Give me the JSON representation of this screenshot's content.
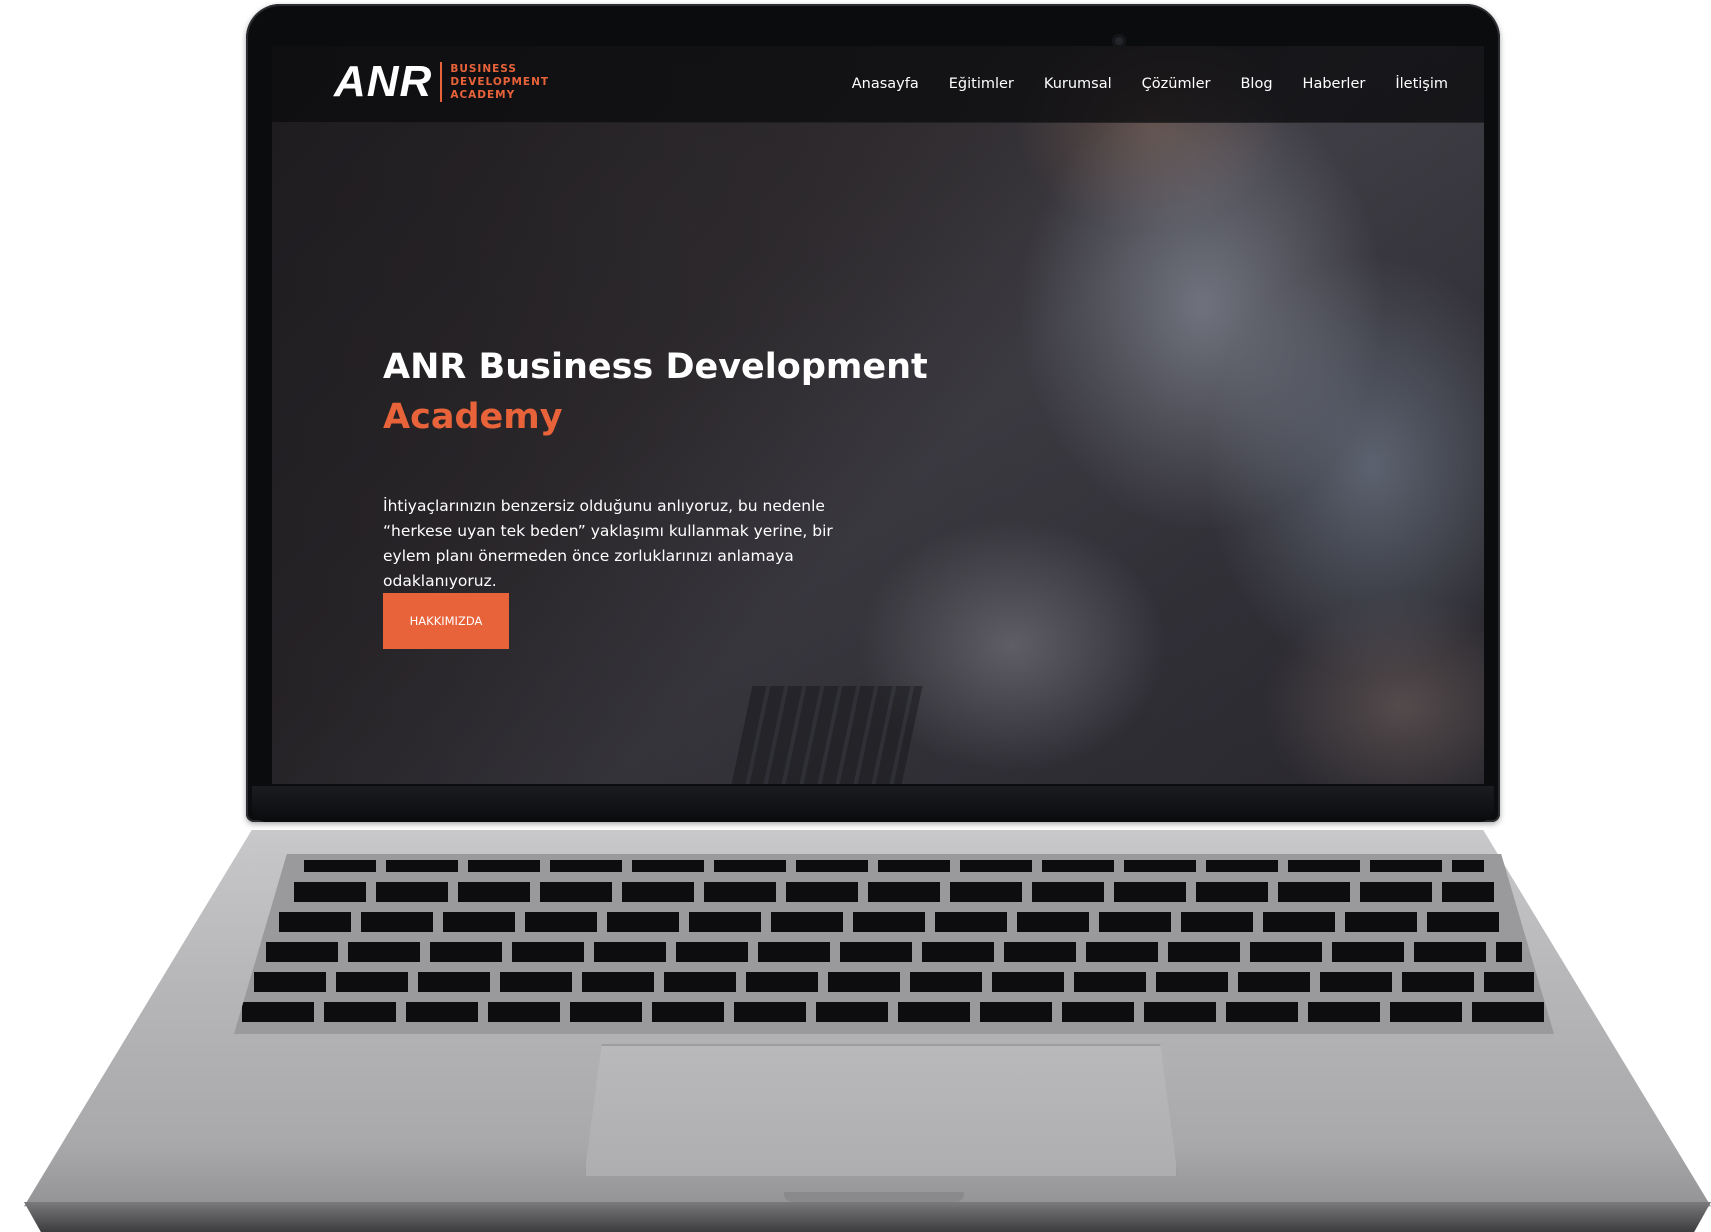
{
  "brand": {
    "logo_mark": "ANR",
    "logo_line1": "BUSINESS",
    "logo_line2": "DEVELOPMENT",
    "logo_line3": "ACADEMY",
    "accent_color": "#e8633a"
  },
  "nav": {
    "items": [
      {
        "label": "Anasayfa"
      },
      {
        "label": "Eğitimler"
      },
      {
        "label": "Kurumsal"
      },
      {
        "label": "Çözümler"
      },
      {
        "label": "Blog"
      },
      {
        "label": "Haberler"
      },
      {
        "label": "İletişim"
      }
    ]
  },
  "hero": {
    "title_line1": "ANR Business Development",
    "title_line2": "Academy",
    "description": "İhtiyaçlarınızın benzersiz olduğunu anlıyoruz, bu nedenle “herkese uyan tek beden” yaklaşımı kullanmak yerine, bir eylem planı önermeden önce zorluklarınızı anlamaya odaklanıyoruz.",
    "button_label": "HAKKIMIZDA"
  }
}
